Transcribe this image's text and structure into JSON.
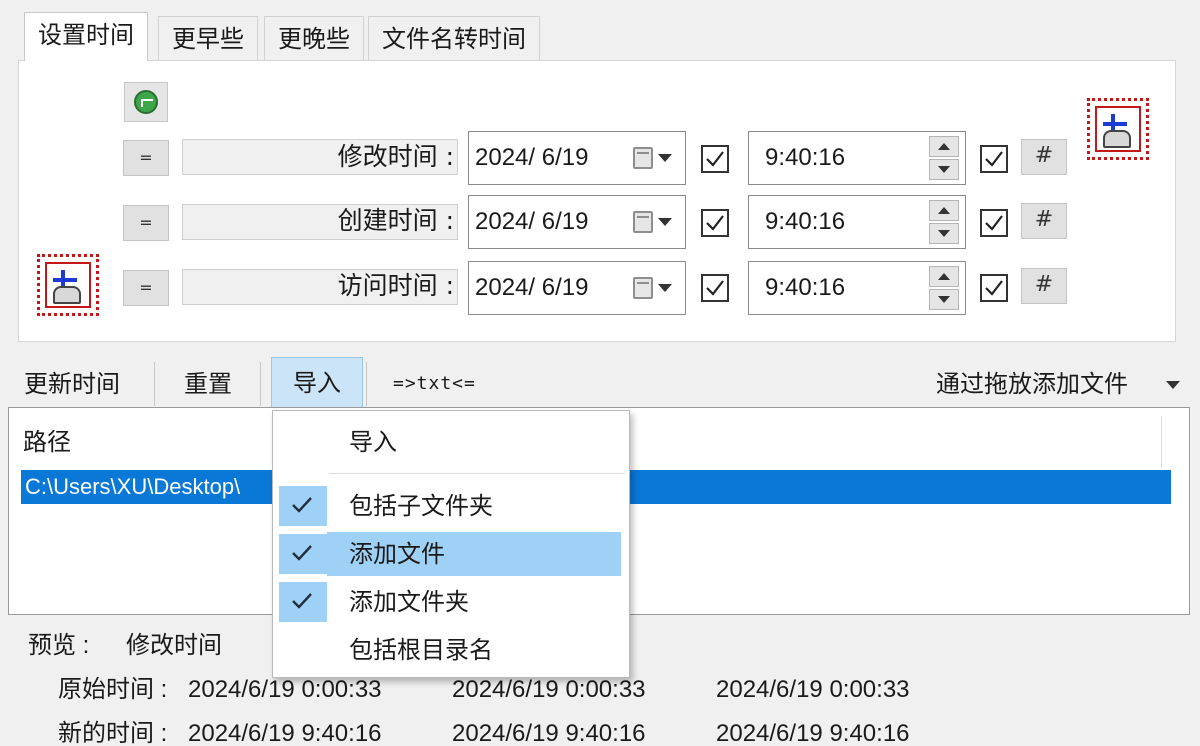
{
  "tabs": [
    "设置时间",
    "更早些",
    "更晚些",
    "文件名转时间"
  ],
  "rows": [
    {
      "label": "修改时间 :",
      "date": "2024/  6/19",
      "time": "9:40:16"
    },
    {
      "label": "创建时间 :",
      "date": "2024/  6/19",
      "time": "9:40:16"
    },
    {
      "label": "访问时间 :",
      "date": "2024/  6/19",
      "time": "9:40:16"
    }
  ],
  "buttons": {
    "equals": "=",
    "hash": "#"
  },
  "toolbar": {
    "update": "更新时间",
    "reset": "重置",
    "import": "导入",
    "txt": "=>txt<=",
    "drag_add": "通过拖放添加文件"
  },
  "list": {
    "column": "路径",
    "selected_path": "C:\\Users\\XU\\Desktop\\"
  },
  "menu": {
    "header": "导入",
    "items": [
      {
        "label": "包括子文件夹",
        "checked": true
      },
      {
        "label": "添加文件",
        "checked": true,
        "highlighted": true
      },
      {
        "label": "添加文件夹",
        "checked": true
      },
      {
        "label": "包括根目录名",
        "checked": false
      }
    ]
  },
  "preview": {
    "label": "预览 :",
    "field": "修改时间",
    "original_label": "原始时间 :",
    "new_label": "新的时间 :",
    "original": [
      "2024/6/19 0:00:33",
      "2024/6/19 0:00:33",
      "2024/6/19 0:00:33"
    ],
    "new": [
      "2024/6/19 9:40:16",
      "2024/6/19 9:40:16",
      "2024/6/19 9:40:16"
    ]
  },
  "colors": {
    "selection": "#0a78d7",
    "menu_highlight": "#9fd0f5",
    "import_active": "#cce4f7"
  }
}
